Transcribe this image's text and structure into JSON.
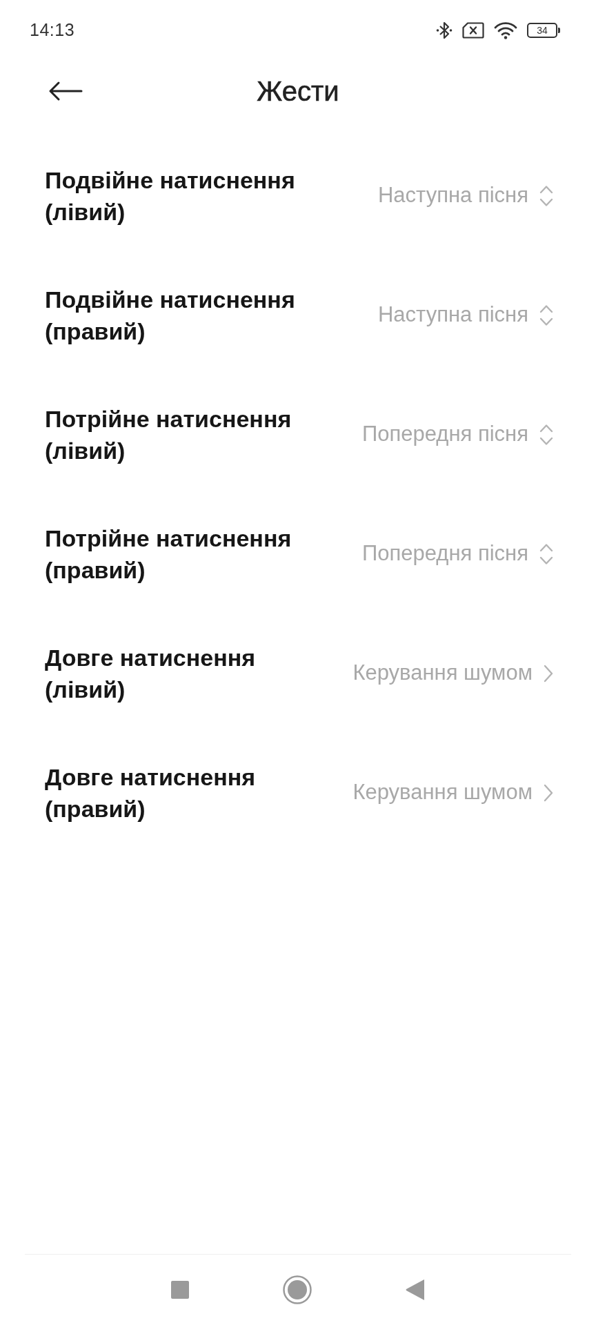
{
  "status_bar": {
    "time": "14:13",
    "battery_text": "34"
  },
  "header": {
    "title": "Жести"
  },
  "gestures": [
    {
      "kind": "select",
      "label": "Подвійне натиснення (лівий)",
      "value": "Наступна пісня"
    },
    {
      "kind": "select",
      "label": "Подвійне натиснення (правий)",
      "value": "Наступна пісня"
    },
    {
      "kind": "select",
      "label": "Потрійне натиснення (лівий)",
      "value": "Попередня пісня"
    },
    {
      "kind": "select",
      "label": "Потрійне натиснення (правий)",
      "value": "Попередня пісня"
    },
    {
      "kind": "navigate",
      "label": "Довге натиснення (лівий)",
      "value": "Керування шумом"
    },
    {
      "kind": "navigate",
      "label": "Довге натиснення (правий)",
      "value": "Керування шумом"
    }
  ]
}
